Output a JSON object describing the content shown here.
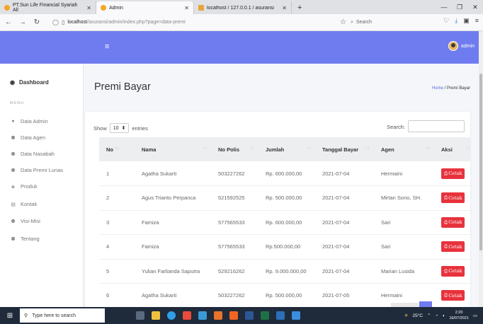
{
  "browser": {
    "tabs": [
      {
        "label": "PT.Sun Life Financial Syariah All",
        "color": "#f5a623"
      },
      {
        "label": "Admin",
        "color": "#f5a623"
      },
      {
        "label": "localhost / 127.0.0.1 / asuransi",
        "color": "#e8a43a"
      }
    ],
    "new_tab": "+",
    "url_host": "localhost",
    "url_path": "/asuransi/admin/index.php?page=data-premi",
    "search_placeholder": "Search"
  },
  "header": {
    "menu_icon": "hamburger-icon",
    "user_label": "admin",
    "bg_color": "#6f7cf0"
  },
  "sidebar": {
    "dashboard": "Dashboard",
    "menu_label": "MENU",
    "items": [
      {
        "label": "Data Admin",
        "icon": "user-icon"
      },
      {
        "label": "Data Agen",
        "icon": "users-icon"
      },
      {
        "label": "Data Nasabah",
        "icon": "users-icon"
      },
      {
        "label": "Data Premi Lunas",
        "icon": "users-icon"
      },
      {
        "label": "Produk",
        "icon": "tag-icon"
      },
      {
        "label": "Kontak",
        "icon": "contact-icon"
      },
      {
        "label": "Visi-Misi",
        "icon": "users-icon"
      },
      {
        "label": "Tentang",
        "icon": "users-icon"
      }
    ]
  },
  "page": {
    "title": "Premi Bayar",
    "breadcrumb_home": "Home",
    "breadcrumb_sep": "/",
    "breadcrumb_current": "Premi Bayar"
  },
  "table_controls": {
    "show_label": "Show",
    "entries_value": "10",
    "entries_label": "entries",
    "search_label": "Search:"
  },
  "table": {
    "columns": [
      "No",
      "Nama",
      "No Polis",
      "Jumlah",
      "Tanggal Bayar",
      "Agen",
      "Aksi"
    ],
    "rows": [
      [
        "1",
        "Agatha Sukarti",
        "503227262",
        "Rp. 600.000,00",
        "2021-07-04",
        "Hermaini"
      ],
      [
        "2",
        "Agus Trianto Perpanca",
        "521592525",
        "Rp. 500.000,00",
        "2021-07-04",
        "Mirtan Sono, SH."
      ],
      [
        "3",
        "Famiza",
        "577565533",
        "Rp. 600.000,00",
        "2021-07-04",
        "Sari"
      ],
      [
        "4",
        "Famiza",
        "577565533",
        "Rp.500.000,00",
        "2021-07-04",
        "Sari"
      ],
      [
        "5",
        "Yulian Farlianda Saputra",
        "529216262",
        "Rp. 9.000.000,00",
        "2021-07-04",
        "Marian Lusida"
      ],
      [
        "6",
        "Agatha Sukarti",
        "503227262",
        "Rp. 500.000,00",
        "2021-07-05",
        "Hermaini"
      ]
    ],
    "action_label": "Cetak",
    "action_color": "#e8323c"
  },
  "taskbar": {
    "search_placeholder": "Type here to search",
    "weather": "25°C",
    "time": "2:20",
    "date": "16/07/2021"
  }
}
